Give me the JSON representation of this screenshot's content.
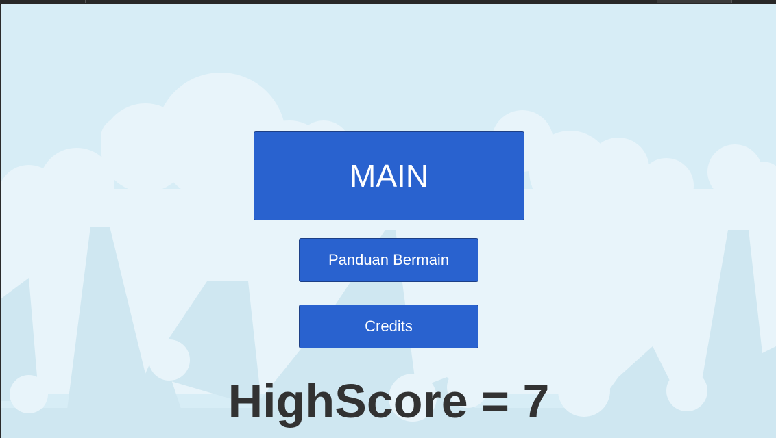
{
  "menu": {
    "play_label": "MAIN",
    "guide_label": "Panduan Bermain",
    "credits_label": "Credits"
  },
  "score": {
    "highscore_text": "HighScore = 7"
  },
  "colors": {
    "sky": "#d6ecf5",
    "cloud": "#e9f4fa",
    "button": "#2962cf",
    "score_text": "#323232"
  }
}
